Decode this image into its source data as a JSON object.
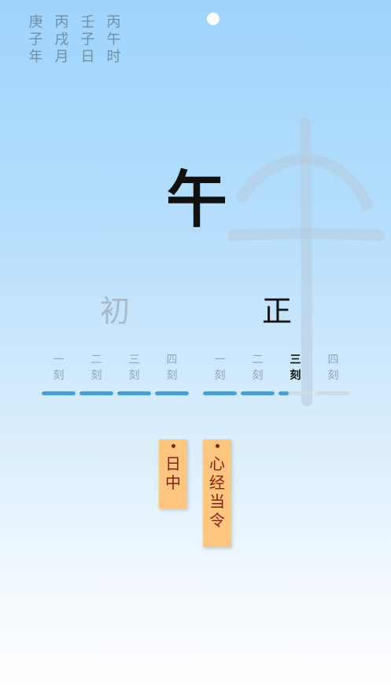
{
  "ganzhi": [
    [
      "庚",
      "子",
      "年"
    ],
    [
      "丙",
      "戌",
      "月"
    ],
    [
      "壬",
      "子",
      "日"
    ],
    [
      "丙",
      "午",
      "时"
    ]
  ],
  "hour": "午",
  "halves": {
    "chu": "初",
    "zheng": "正"
  },
  "ke": {
    "chu": [
      {
        "top": "一",
        "bottom": "刻",
        "progress": 1.0
      },
      {
        "top": "二",
        "bottom": "刻",
        "progress": 1.0
      },
      {
        "top": "三",
        "bottom": "刻",
        "progress": 1.0
      },
      {
        "top": "四",
        "bottom": "刻",
        "progress": 1.0
      }
    ],
    "zheng": [
      {
        "top": "一",
        "bottom": "刻",
        "progress": 1.0
      },
      {
        "top": "二",
        "bottom": "刻",
        "progress": 1.0
      },
      {
        "top": "三",
        "bottom": "刻",
        "progress": 0.3,
        "active": true
      },
      {
        "top": "四",
        "bottom": "刻",
        "progress": 0.0
      }
    ]
  },
  "tags": [
    {
      "chars": [
        "日",
        "中"
      ]
    },
    {
      "chars": [
        "心",
        "经",
        "当",
        "令"
      ]
    }
  ],
  "colors": {
    "bar_fill": "#4b9ed4",
    "bar_track": "#cfdbe5",
    "tag_bg": "#ffc67f",
    "tag_text": "#8a1f12"
  }
}
